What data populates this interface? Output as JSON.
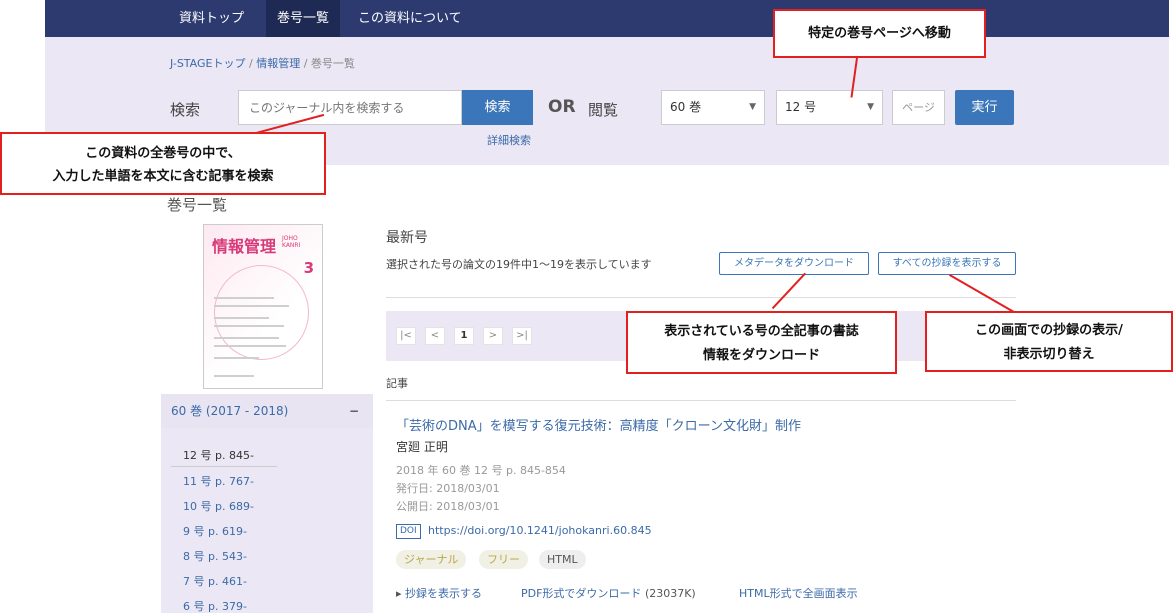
{
  "nav": {
    "items": [
      "資料トップ",
      "巻号一覧",
      "この資料について"
    ],
    "active_index": 1
  },
  "breadcrumb": {
    "items": [
      "J-STAGEトップ",
      "情報管理",
      "巻号一覧"
    ],
    "separator": "/"
  },
  "search": {
    "label": "検索",
    "placeholder": "このジャーナル内を検索する",
    "button": "検索",
    "advanced_link": "詳細検索",
    "or_label": "OR",
    "browse_label": "閲覧",
    "volume_select": "60 巻",
    "issue_select": "12 号",
    "page_placeholder": "ページ",
    "run_button": "実行"
  },
  "section_title": "巻号一覧",
  "cover": {
    "title": "情報管理",
    "subtitle_line1": "JOHO",
    "subtitle_line2": "KANRI",
    "issue_number": "3"
  },
  "sidebar": {
    "volume": "60 巻 (2017 - 2018)",
    "collapse": "−",
    "issues": [
      "12 号 p. 845-",
      "11 号 p. 767-",
      "10 号 p. 689-",
      "9 号 p. 619-",
      "8 号 p. 543-",
      "7 号 p. 461-",
      "6 号 p. 379-"
    ]
  },
  "main": {
    "latest_label": "最新号",
    "count_text": "選択された号の論文の19件中1～19を表示しています",
    "download_metadata": "メタデータをダウンロード",
    "show_all_abstracts": "すべての抄録を表示する",
    "pager": [
      "|<",
      "<",
      "1",
      ">",
      ">|"
    ],
    "articles_label": "記事"
  },
  "article": {
    "title": "「芸術のDNA」を模写する復元技術：高精度「クローン文化財」制作",
    "author": "宮廻 正明",
    "citation": "2018 年 60 巻 12 号 p. 845-854",
    "issued": "発行日: 2018/03/01",
    "published": "公開日: 2018/03/01",
    "doi_badge": "DOI",
    "doi_url": "https://doi.org/10.1241/johokanri.60.845",
    "tags": [
      "ジャーナル",
      "フリー",
      "HTML"
    ],
    "show_abstract": "抄録を表示する",
    "pdf_download": "PDF形式でダウンロード",
    "pdf_size": "(23037K)",
    "html_full": "HTML形式で全画面表示"
  },
  "callouts": {
    "jump": "特定の巻号ページへ移動",
    "search_line1": "この資料の全巻号の中で、",
    "search_line2": "入力した単語を本文に含む記事を検索",
    "download_line1": "表示されている号の全記事の書誌",
    "download_line2": "情報をダウンロード",
    "abstract_line1": "この画面での抄録の表示/",
    "abstract_line2": "非表示切り替え"
  },
  "colors": {
    "nav_bg": "#2c3a6f",
    "band_bg": "#ece7f4",
    "primary": "#3a76b9",
    "callout_red": "#e32020"
  }
}
